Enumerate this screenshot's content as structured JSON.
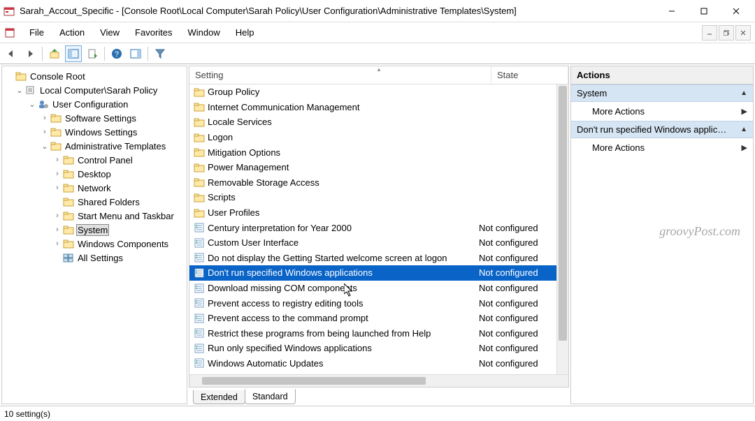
{
  "window": {
    "title": "Sarah_Accout_Specific - [Console Root\\Local Computer\\Sarah Policy\\User Configuration\\Administrative Templates\\System]"
  },
  "menu": {
    "file": "File",
    "action": "Action",
    "view": "View",
    "favorites": "Favorites",
    "window": "Window",
    "help": "Help"
  },
  "tree": {
    "root": "Console Root",
    "root_child": "Local Computer\\Sarah Policy",
    "user_config": "User Configuration",
    "software": "Software Settings",
    "windows_settings": "Windows Settings",
    "admin_templates": "Administrative Templates",
    "control_panel": "Control Panel",
    "desktop": "Desktop",
    "network": "Network",
    "shared_folders": "Shared Folders",
    "start_menu": "Start Menu and Taskbar",
    "system": "System",
    "windows_components": "Windows Components",
    "all_settings": "All Settings"
  },
  "list": {
    "header_setting": "Setting",
    "header_state": "State",
    "rows": [
      {
        "type": "folder",
        "name": "Group Policy",
        "state": ""
      },
      {
        "type": "folder",
        "name": "Internet Communication Management",
        "state": ""
      },
      {
        "type": "folder",
        "name": "Locale Services",
        "state": ""
      },
      {
        "type": "folder",
        "name": "Logon",
        "state": ""
      },
      {
        "type": "folder",
        "name": "Mitigation Options",
        "state": ""
      },
      {
        "type": "folder",
        "name": "Power Management",
        "state": ""
      },
      {
        "type": "folder",
        "name": "Removable Storage Access",
        "state": ""
      },
      {
        "type": "folder",
        "name": "Scripts",
        "state": ""
      },
      {
        "type": "folder",
        "name": "User Profiles",
        "state": ""
      },
      {
        "type": "setting",
        "name": "Century interpretation for Year 2000",
        "state": "Not configured"
      },
      {
        "type": "setting",
        "name": "Custom User Interface",
        "state": "Not configured"
      },
      {
        "type": "setting",
        "name": "Do not display the Getting Started welcome screen at logon",
        "state": "Not configured"
      },
      {
        "type": "setting",
        "name": "Don't run specified Windows applications",
        "state": "Not configured",
        "selected": true
      },
      {
        "type": "setting",
        "name": "Download missing COM components",
        "state": "Not configured"
      },
      {
        "type": "setting",
        "name": "Prevent access to registry editing tools",
        "state": "Not configured"
      },
      {
        "type": "setting",
        "name": "Prevent access to the command prompt",
        "state": "Not configured"
      },
      {
        "type": "setting",
        "name": "Restrict these programs from being launched from Help",
        "state": "Not configured"
      },
      {
        "type": "setting",
        "name": "Run only specified Windows applications",
        "state": "Not configured"
      },
      {
        "type": "setting",
        "name": "Windows Automatic Updates",
        "state": "Not configured"
      }
    ]
  },
  "tabs": {
    "extended": "Extended",
    "standard": "Standard"
  },
  "actions": {
    "title": "Actions",
    "group1": "System",
    "item1": "More Actions",
    "group2": "Don't run specified Windows applicat...",
    "item2": "More Actions"
  },
  "status": {
    "text": "10 setting(s)"
  },
  "watermark": "groovyPost.com"
}
